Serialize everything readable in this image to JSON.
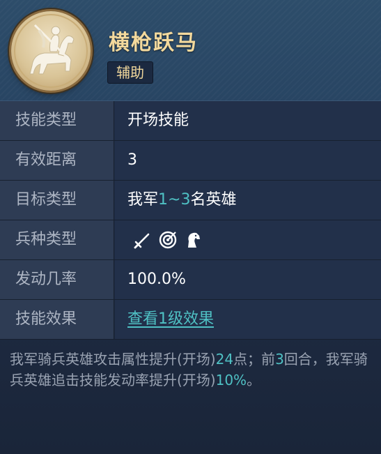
{
  "skill": {
    "name": "横枪跃马",
    "tag": "辅助"
  },
  "rows": [
    {
      "label": "技能类型",
      "value": "开场技能"
    },
    {
      "label": "有效距离",
      "value": "3"
    },
    {
      "label": "目标类型",
      "value_prefix": "我军",
      "value_highlight": "1~3",
      "value_suffix": "名英雄"
    },
    {
      "label": "兵种类型",
      "icons": [
        "sword-icon",
        "bow-target-icon",
        "horse-head-icon"
      ]
    },
    {
      "label": "发动几率",
      "value": "100.0%"
    },
    {
      "label": "技能效果",
      "value": "查看1级效果"
    }
  ],
  "description": {
    "p1": "我军骑兵英雄攻击属性提升(开场)",
    "n1": "24",
    "p2": "点；前",
    "n2": "3",
    "p3": "回合，我军骑兵英雄追击技能发动率提升(开场)",
    "n3": "10%",
    "p4": "。"
  },
  "colors": {
    "accent_teal": "#4fc1c4",
    "title_gold": "#f3d99d"
  }
}
